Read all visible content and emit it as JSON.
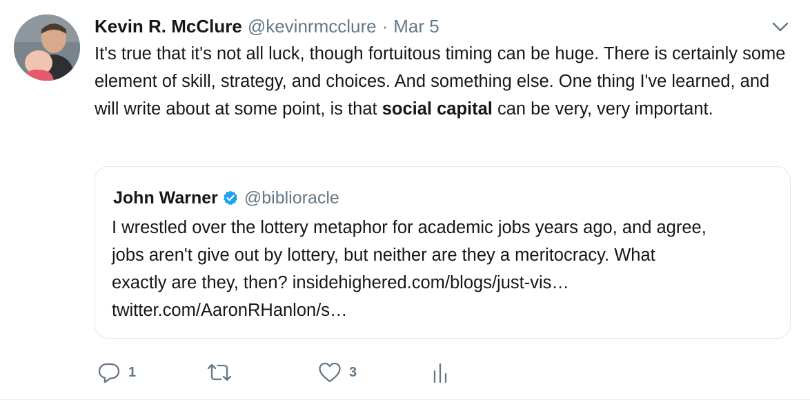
{
  "tweet": {
    "author_name": "Kevin R. McClure",
    "author_handle": "@kevinrmcclure",
    "separator": "·",
    "date": "Mar 5",
    "text_before_bold": "It's true that it's not all luck, though fortuitous timing can be huge. There is certainly some element of skill, strategy, and choices. And something else. One thing I've learned, and will write about at some point, is that ",
    "text_bold": "social capital",
    "text_after_bold": " can be very, very important."
  },
  "quote": {
    "author_name": "John Warner",
    "author_handle": "@biblioracle",
    "lines": [
      "I wrestled over the lottery metaphor for academic jobs years ago, and agree,",
      "jobs aren't give out by lottery, but neither are they a meritocracy. What",
      "exactly are they, then? insidehighered.com/blogs/just-vis…",
      "twitter.com/AaronRHanlon/s…"
    ]
  },
  "actions": {
    "reply_count": "1",
    "retweet_count": "",
    "like_count": "3"
  },
  "icons": {
    "caret": "chevron-down-icon",
    "verified": "verified-badge-icon",
    "reply": "reply-icon",
    "retweet": "retweet-icon",
    "like": "heart-icon",
    "analytics": "analytics-icon"
  },
  "colors": {
    "text": "#14171a",
    "secondary": "#657786",
    "verified_blue": "#1da1f2",
    "border": "#e1e8ed"
  }
}
